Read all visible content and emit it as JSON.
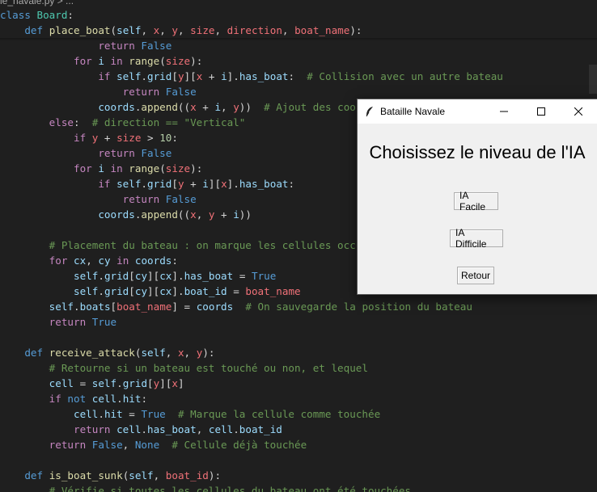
{
  "editor": {
    "breadcrumb": "le_navale.py > ...",
    "lines": [
      [
        [
          "kwb",
          "class "
        ],
        [
          "cls",
          "Board"
        ],
        [
          "txt",
          ":"
        ]
      ],
      [
        [
          "txt",
          "    "
        ],
        [
          "kwb",
          "def "
        ],
        [
          "fn",
          "place_boat"
        ],
        [
          "txt",
          "("
        ],
        [
          "var",
          "self"
        ],
        [
          "txt",
          ", "
        ],
        [
          "par",
          "x"
        ],
        [
          "txt",
          ", "
        ],
        [
          "par",
          "y"
        ],
        [
          "txt",
          ", "
        ],
        [
          "par",
          "size"
        ],
        [
          "txt",
          ", "
        ],
        [
          "par",
          "direction"
        ],
        [
          "txt",
          ", "
        ],
        [
          "par",
          "boat_name"
        ],
        [
          "txt",
          "):"
        ]
      ],
      [
        [
          "txt",
          "                "
        ],
        [
          "kw",
          "return "
        ],
        [
          "kwb",
          "False"
        ]
      ],
      [
        [
          "txt",
          "            "
        ],
        [
          "kw",
          "for "
        ],
        [
          "var",
          "i"
        ],
        [
          "kw",
          " in "
        ],
        [
          "fn",
          "range"
        ],
        [
          "txt",
          "("
        ],
        [
          "par",
          "size"
        ],
        [
          "txt",
          "):"
        ]
      ],
      [
        [
          "txt",
          "                "
        ],
        [
          "kw",
          "if "
        ],
        [
          "var",
          "self"
        ],
        [
          "txt",
          "."
        ],
        [
          "var",
          "grid"
        ],
        [
          "txt",
          "["
        ],
        [
          "par",
          "y"
        ],
        [
          "txt",
          "]["
        ],
        [
          "par",
          "x"
        ],
        [
          "op",
          " + "
        ],
        [
          "var",
          "i"
        ],
        [
          "txt",
          "]."
        ],
        [
          "var",
          "has_boat"
        ],
        [
          "txt",
          ":  "
        ],
        [
          "com",
          "# Collision avec un autre bateau"
        ]
      ],
      [
        [
          "txt",
          "                    "
        ],
        [
          "kw",
          "return "
        ],
        [
          "kwb",
          "False"
        ]
      ],
      [
        [
          "txt",
          "                "
        ],
        [
          "var",
          "coords"
        ],
        [
          "txt",
          "."
        ],
        [
          "fn",
          "append"
        ],
        [
          "txt",
          "(("
        ],
        [
          "par",
          "x"
        ],
        [
          "op",
          " + "
        ],
        [
          "var",
          "i"
        ],
        [
          "txt",
          ", "
        ],
        [
          "par",
          "y"
        ],
        [
          "txt",
          "))  "
        ],
        [
          "com",
          "# Ajout des coordonnées"
        ]
      ],
      [
        [
          "txt",
          "        "
        ],
        [
          "kw",
          "else"
        ],
        [
          "txt",
          ":  "
        ],
        [
          "com",
          "# direction == \"Vertical\""
        ]
      ],
      [
        [
          "txt",
          "            "
        ],
        [
          "kw",
          "if "
        ],
        [
          "par",
          "y"
        ],
        [
          "op",
          " + "
        ],
        [
          "par",
          "size"
        ],
        [
          "op",
          " > "
        ],
        [
          "num",
          "10"
        ],
        [
          "txt",
          ":"
        ]
      ],
      [
        [
          "txt",
          "                "
        ],
        [
          "kw",
          "return "
        ],
        [
          "kwb",
          "False"
        ]
      ],
      [
        [
          "txt",
          "            "
        ],
        [
          "kw",
          "for "
        ],
        [
          "var",
          "i"
        ],
        [
          "kw",
          " in "
        ],
        [
          "fn",
          "range"
        ],
        [
          "txt",
          "("
        ],
        [
          "par",
          "size"
        ],
        [
          "txt",
          "):"
        ]
      ],
      [
        [
          "txt",
          "                "
        ],
        [
          "kw",
          "if "
        ],
        [
          "var",
          "self"
        ],
        [
          "txt",
          "."
        ],
        [
          "var",
          "grid"
        ],
        [
          "txt",
          "["
        ],
        [
          "par",
          "y"
        ],
        [
          "op",
          " + "
        ],
        [
          "var",
          "i"
        ],
        [
          "txt",
          "]["
        ],
        [
          "par",
          "x"
        ],
        [
          "txt",
          "]."
        ],
        [
          "var",
          "has_boat"
        ],
        [
          "txt",
          ":"
        ]
      ],
      [
        [
          "txt",
          "                    "
        ],
        [
          "kw",
          "return "
        ],
        [
          "kwb",
          "False"
        ]
      ],
      [
        [
          "txt",
          "                "
        ],
        [
          "var",
          "coords"
        ],
        [
          "txt",
          "."
        ],
        [
          "fn",
          "append"
        ],
        [
          "txt",
          "(("
        ],
        [
          "par",
          "x"
        ],
        [
          "txt",
          ", "
        ],
        [
          "par",
          "y"
        ],
        [
          "op",
          " + "
        ],
        [
          "var",
          "i"
        ],
        [
          "txt",
          "))"
        ]
      ],
      [
        [
          "txt",
          ""
        ]
      ],
      [
        [
          "txt",
          "        "
        ],
        [
          "com",
          "# Placement du bateau : on marque les cellules occupées"
        ]
      ],
      [
        [
          "txt",
          "        "
        ],
        [
          "kw",
          "for "
        ],
        [
          "var",
          "cx"
        ],
        [
          "txt",
          ", "
        ],
        [
          "var",
          "cy"
        ],
        [
          "kw",
          " in "
        ],
        [
          "var",
          "coords"
        ],
        [
          "txt",
          ":"
        ]
      ],
      [
        [
          "txt",
          "            "
        ],
        [
          "var",
          "self"
        ],
        [
          "txt",
          "."
        ],
        [
          "var",
          "grid"
        ],
        [
          "txt",
          "["
        ],
        [
          "var",
          "cy"
        ],
        [
          "txt",
          "]["
        ],
        [
          "var",
          "cx"
        ],
        [
          "txt",
          "]."
        ],
        [
          "var",
          "has_boat"
        ],
        [
          "op",
          " = "
        ],
        [
          "kwb",
          "True"
        ]
      ],
      [
        [
          "txt",
          "            "
        ],
        [
          "var",
          "self"
        ],
        [
          "txt",
          "."
        ],
        [
          "var",
          "grid"
        ],
        [
          "txt",
          "["
        ],
        [
          "var",
          "cy"
        ],
        [
          "txt",
          "]["
        ],
        [
          "var",
          "cx"
        ],
        [
          "txt",
          "]."
        ],
        [
          "var",
          "boat_id"
        ],
        [
          "op",
          " = "
        ],
        [
          "par",
          "boat_name"
        ]
      ],
      [
        [
          "txt",
          "        "
        ],
        [
          "var",
          "self"
        ],
        [
          "txt",
          "."
        ],
        [
          "var",
          "boats"
        ],
        [
          "txt",
          "["
        ],
        [
          "par",
          "boat_name"
        ],
        [
          "txt",
          "]"
        ],
        [
          "op",
          " = "
        ],
        [
          "var",
          "coords"
        ],
        [
          "txt",
          "  "
        ],
        [
          "com",
          "# On sauvegarde la position du bateau"
        ]
      ],
      [
        [
          "txt",
          "        "
        ],
        [
          "kw",
          "return "
        ],
        [
          "kwb",
          "True"
        ]
      ],
      [
        [
          "txt",
          ""
        ]
      ],
      [
        [
          "txt",
          "    "
        ],
        [
          "kwb",
          "def "
        ],
        [
          "fn",
          "receive_attack"
        ],
        [
          "txt",
          "("
        ],
        [
          "var",
          "self"
        ],
        [
          "txt",
          ", "
        ],
        [
          "par",
          "x"
        ],
        [
          "txt",
          ", "
        ],
        [
          "par",
          "y"
        ],
        [
          "txt",
          "):"
        ]
      ],
      [
        [
          "txt",
          "        "
        ],
        [
          "com",
          "# Retourne si un bateau est touché ou non, et lequel"
        ]
      ],
      [
        [
          "txt",
          "        "
        ],
        [
          "var",
          "cell"
        ],
        [
          "op",
          " = "
        ],
        [
          "var",
          "self"
        ],
        [
          "txt",
          "."
        ],
        [
          "var",
          "grid"
        ],
        [
          "txt",
          "["
        ],
        [
          "par",
          "y"
        ],
        [
          "txt",
          "]["
        ],
        [
          "par",
          "x"
        ],
        [
          "txt",
          "]"
        ]
      ],
      [
        [
          "txt",
          "        "
        ],
        [
          "kw",
          "if "
        ],
        [
          "kwb",
          "not "
        ],
        [
          "var",
          "cell"
        ],
        [
          "txt",
          "."
        ],
        [
          "var",
          "hit"
        ],
        [
          "txt",
          ":"
        ]
      ],
      [
        [
          "txt",
          "            "
        ],
        [
          "var",
          "cell"
        ],
        [
          "txt",
          "."
        ],
        [
          "var",
          "hit"
        ],
        [
          "op",
          " = "
        ],
        [
          "kwb",
          "True"
        ],
        [
          "txt",
          "  "
        ],
        [
          "com",
          "# Marque la cellule comme touchée"
        ]
      ],
      [
        [
          "txt",
          "            "
        ],
        [
          "kw",
          "return "
        ],
        [
          "var",
          "cell"
        ],
        [
          "txt",
          "."
        ],
        [
          "var",
          "has_boat"
        ],
        [
          "txt",
          ", "
        ],
        [
          "var",
          "cell"
        ],
        [
          "txt",
          "."
        ],
        [
          "var",
          "boat_id"
        ]
      ],
      [
        [
          "txt",
          "        "
        ],
        [
          "kw",
          "return "
        ],
        [
          "kwb",
          "False"
        ],
        [
          "txt",
          ", "
        ],
        [
          "kwb",
          "None"
        ],
        [
          "txt",
          "  "
        ],
        [
          "com",
          "# Cellule déjà touchée"
        ]
      ],
      [
        [
          "txt",
          ""
        ]
      ],
      [
        [
          "txt",
          "    "
        ],
        [
          "kwb",
          "def "
        ],
        [
          "fn",
          "is_boat_sunk"
        ],
        [
          "txt",
          "("
        ],
        [
          "var",
          "self"
        ],
        [
          "txt",
          ", "
        ],
        [
          "par",
          "boat_id"
        ],
        [
          "txt",
          "):"
        ]
      ],
      [
        [
          "txt",
          "        "
        ],
        [
          "com",
          "# Vérifie si toutes les cellules du bateau ont été touchées"
        ]
      ]
    ]
  },
  "dialog": {
    "title": "Bataille Navale",
    "heading": "Choisissez le niveau de l'IA",
    "buttons": {
      "easy": "IA Facile",
      "hard": "IA Difficile",
      "back": "Retour"
    },
    "titlebar_icons": [
      "feather-icon",
      "minimize-icon",
      "maximize-icon",
      "close-icon"
    ]
  }
}
